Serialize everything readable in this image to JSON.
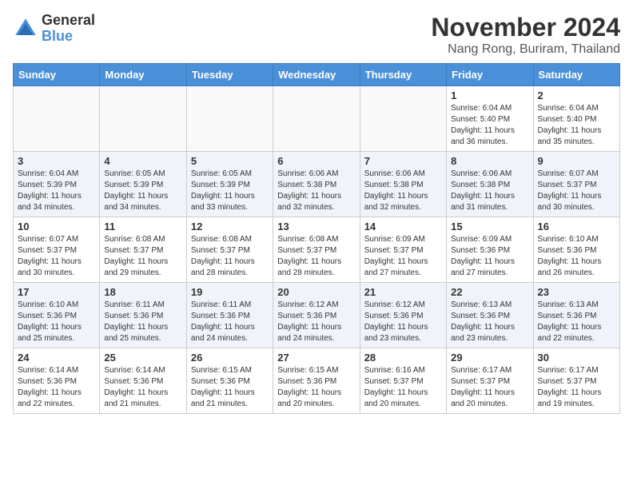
{
  "logo": {
    "general": "General",
    "blue": "Blue"
  },
  "title": {
    "month": "November 2024",
    "location": "Nang Rong, Buriram, Thailand"
  },
  "weekdays": [
    "Sunday",
    "Monday",
    "Tuesday",
    "Wednesday",
    "Thursday",
    "Friday",
    "Saturday"
  ],
  "weeks": [
    {
      "shaded": false,
      "days": [
        {
          "date": "",
          "info": ""
        },
        {
          "date": "",
          "info": ""
        },
        {
          "date": "",
          "info": ""
        },
        {
          "date": "",
          "info": ""
        },
        {
          "date": "",
          "info": ""
        },
        {
          "date": "1",
          "info": "Sunrise: 6:04 AM\nSunset: 5:40 PM\nDaylight: 11 hours and 36 minutes."
        },
        {
          "date": "2",
          "info": "Sunrise: 6:04 AM\nSunset: 5:40 PM\nDaylight: 11 hours and 35 minutes."
        }
      ]
    },
    {
      "shaded": true,
      "days": [
        {
          "date": "3",
          "info": "Sunrise: 6:04 AM\nSunset: 5:39 PM\nDaylight: 11 hours and 34 minutes."
        },
        {
          "date": "4",
          "info": "Sunrise: 6:05 AM\nSunset: 5:39 PM\nDaylight: 11 hours and 34 minutes."
        },
        {
          "date": "5",
          "info": "Sunrise: 6:05 AM\nSunset: 5:39 PM\nDaylight: 11 hours and 33 minutes."
        },
        {
          "date": "6",
          "info": "Sunrise: 6:06 AM\nSunset: 5:38 PM\nDaylight: 11 hours and 32 minutes."
        },
        {
          "date": "7",
          "info": "Sunrise: 6:06 AM\nSunset: 5:38 PM\nDaylight: 11 hours and 32 minutes."
        },
        {
          "date": "8",
          "info": "Sunrise: 6:06 AM\nSunset: 5:38 PM\nDaylight: 11 hours and 31 minutes."
        },
        {
          "date": "9",
          "info": "Sunrise: 6:07 AM\nSunset: 5:37 PM\nDaylight: 11 hours and 30 minutes."
        }
      ]
    },
    {
      "shaded": false,
      "days": [
        {
          "date": "10",
          "info": "Sunrise: 6:07 AM\nSunset: 5:37 PM\nDaylight: 11 hours and 30 minutes."
        },
        {
          "date": "11",
          "info": "Sunrise: 6:08 AM\nSunset: 5:37 PM\nDaylight: 11 hours and 29 minutes."
        },
        {
          "date": "12",
          "info": "Sunrise: 6:08 AM\nSunset: 5:37 PM\nDaylight: 11 hours and 28 minutes."
        },
        {
          "date": "13",
          "info": "Sunrise: 6:08 AM\nSunset: 5:37 PM\nDaylight: 11 hours and 28 minutes."
        },
        {
          "date": "14",
          "info": "Sunrise: 6:09 AM\nSunset: 5:37 PM\nDaylight: 11 hours and 27 minutes."
        },
        {
          "date": "15",
          "info": "Sunrise: 6:09 AM\nSunset: 5:36 PM\nDaylight: 11 hours and 27 minutes."
        },
        {
          "date": "16",
          "info": "Sunrise: 6:10 AM\nSunset: 5:36 PM\nDaylight: 11 hours and 26 minutes."
        }
      ]
    },
    {
      "shaded": true,
      "days": [
        {
          "date": "17",
          "info": "Sunrise: 6:10 AM\nSunset: 5:36 PM\nDaylight: 11 hours and 25 minutes."
        },
        {
          "date": "18",
          "info": "Sunrise: 6:11 AM\nSunset: 5:36 PM\nDaylight: 11 hours and 25 minutes."
        },
        {
          "date": "19",
          "info": "Sunrise: 6:11 AM\nSunset: 5:36 PM\nDaylight: 11 hours and 24 minutes."
        },
        {
          "date": "20",
          "info": "Sunrise: 6:12 AM\nSunset: 5:36 PM\nDaylight: 11 hours and 24 minutes."
        },
        {
          "date": "21",
          "info": "Sunrise: 6:12 AM\nSunset: 5:36 PM\nDaylight: 11 hours and 23 minutes."
        },
        {
          "date": "22",
          "info": "Sunrise: 6:13 AM\nSunset: 5:36 PM\nDaylight: 11 hours and 23 minutes."
        },
        {
          "date": "23",
          "info": "Sunrise: 6:13 AM\nSunset: 5:36 PM\nDaylight: 11 hours and 22 minutes."
        }
      ]
    },
    {
      "shaded": false,
      "days": [
        {
          "date": "24",
          "info": "Sunrise: 6:14 AM\nSunset: 5:36 PM\nDaylight: 11 hours and 22 minutes."
        },
        {
          "date": "25",
          "info": "Sunrise: 6:14 AM\nSunset: 5:36 PM\nDaylight: 11 hours and 21 minutes."
        },
        {
          "date": "26",
          "info": "Sunrise: 6:15 AM\nSunset: 5:36 PM\nDaylight: 11 hours and 21 minutes."
        },
        {
          "date": "27",
          "info": "Sunrise: 6:15 AM\nSunset: 5:36 PM\nDaylight: 11 hours and 20 minutes."
        },
        {
          "date": "28",
          "info": "Sunrise: 6:16 AM\nSunset: 5:37 PM\nDaylight: 11 hours and 20 minutes."
        },
        {
          "date": "29",
          "info": "Sunrise: 6:17 AM\nSunset: 5:37 PM\nDaylight: 11 hours and 20 minutes."
        },
        {
          "date": "30",
          "info": "Sunrise: 6:17 AM\nSunset: 5:37 PM\nDaylight: 11 hours and 19 minutes."
        }
      ]
    }
  ]
}
